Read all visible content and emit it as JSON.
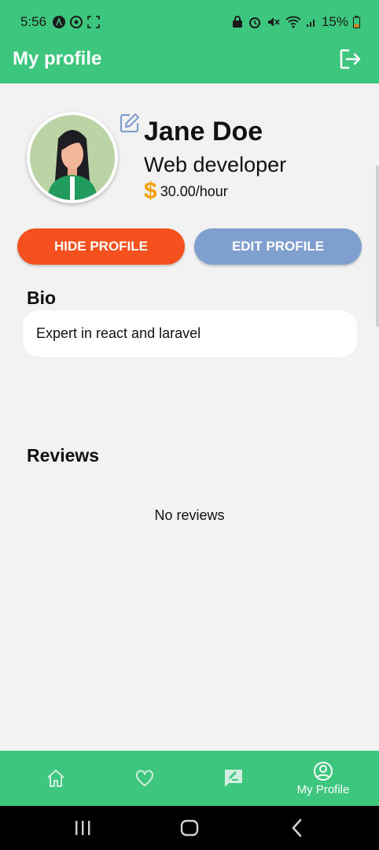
{
  "status_bar": {
    "time": "5:56",
    "battery": "15%"
  },
  "app_bar": {
    "title": "My profile"
  },
  "profile": {
    "name": "Jane Doe",
    "job_title": "Web developer",
    "rate": "30.00/hour",
    "currency_symbol": "$"
  },
  "actions": {
    "hide_label": "HIDE PROFILE",
    "edit_label": "EDIT PROFILE"
  },
  "bio": {
    "heading": "Bio",
    "text": "Expert in react and laravel"
  },
  "reviews": {
    "heading": "Reviews",
    "empty_text": "No reviews"
  },
  "bottom_nav": {
    "items": [
      {
        "icon": "home-icon",
        "label": ""
      },
      {
        "icon": "heart-icon",
        "label": ""
      },
      {
        "icon": "chat-edit-icon",
        "label": ""
      },
      {
        "icon": "account-circle-icon",
        "label": "My Profile"
      }
    ]
  },
  "colors": {
    "brand_green": "#3dc67d",
    "hide_button": "#f4511e",
    "edit_button": "#7f9fce",
    "rate_icon": "#f5a000"
  }
}
